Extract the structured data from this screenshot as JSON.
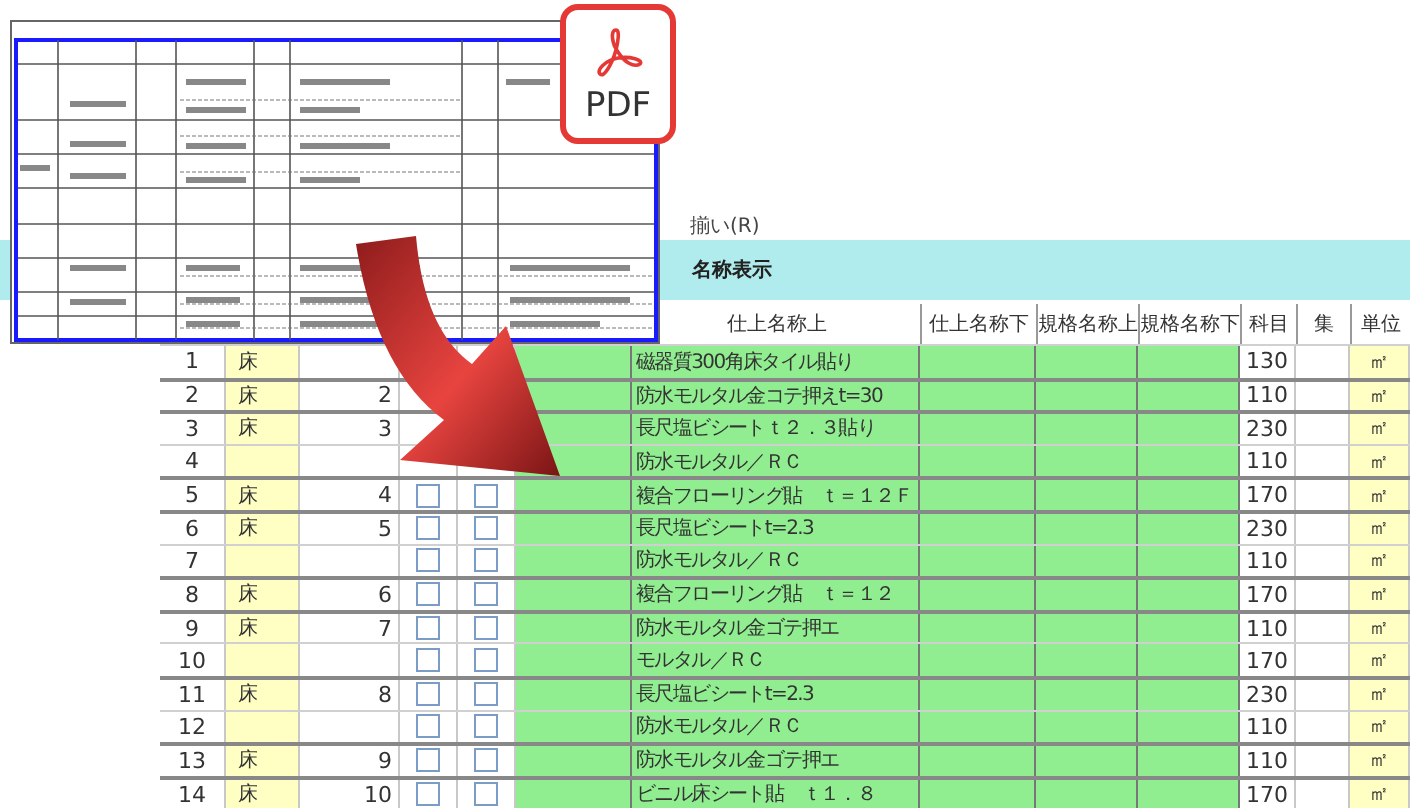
{
  "pdf_badge": {
    "label": "PDF"
  },
  "toolbar": {
    "align_label": "揃い(R)"
  },
  "name_panel": {
    "title": "名称表示"
  },
  "table": {
    "columns": [
      "仕上名称上",
      "仕上名称下",
      "規格名称上",
      "規格名称下",
      "科目",
      "集",
      "単位"
    ],
    "rows": [
      {
        "no": "1",
        "column_2": "床",
        "column_3": "",
        "finish_upper": "磁器質300角床タイル貼り",
        "subject": "130",
        "unit": "㎡"
      },
      {
        "no": "2",
        "column_2": "床",
        "column_3": "2",
        "finish_upper": "防水モルタル金コテ押えt=30",
        "subject": "110",
        "unit": "㎡"
      },
      {
        "no": "3",
        "column_2": "床",
        "column_3": "3",
        "finish_upper": "長尺塩ビシートｔ２．３貼り",
        "subject": "230",
        "unit": "㎡"
      },
      {
        "no": "4",
        "column_2": "",
        "column_3": "",
        "finish_upper": "防水モルタル／ＲＣ",
        "subject": "110",
        "unit": "㎡"
      },
      {
        "no": "5",
        "column_2": "床",
        "column_3": "4",
        "check_a": false,
        "check_b": false,
        "finish_upper": "複合フローリング貼　ｔ＝１２Ｆ",
        "subject": "170",
        "unit": "㎡"
      },
      {
        "no": "6",
        "column_2": "床",
        "column_3": "5",
        "check_a": false,
        "check_b": false,
        "finish_upper": "長尺塩ビシートt=2.3",
        "subject": "230",
        "unit": "㎡"
      },
      {
        "no": "7",
        "column_2": "",
        "column_3": "",
        "check_a": false,
        "check_b": false,
        "finish_upper": "防水モルタル／ＲＣ",
        "subject": "110",
        "unit": "㎡"
      },
      {
        "no": "8",
        "column_2": "床",
        "column_3": "6",
        "check_a": false,
        "check_b": false,
        "finish_upper": "複合フローリング貼　ｔ＝１２",
        "subject": "170",
        "unit": "㎡"
      },
      {
        "no": "9",
        "column_2": "床",
        "column_3": "7",
        "check_a": false,
        "check_b": false,
        "finish_upper": "防水モルタル金ゴテ押エ",
        "subject": "110",
        "unit": "㎡"
      },
      {
        "no": "10",
        "column_2": "",
        "column_3": "",
        "check_a": false,
        "check_b": false,
        "finish_upper": "モルタル／ＲＣ",
        "subject": "170",
        "unit": "㎡"
      },
      {
        "no": "11",
        "column_2": "床",
        "column_3": "8",
        "check_a": false,
        "check_b": false,
        "finish_upper": "長尺塩ビシートt=2.3",
        "subject": "230",
        "unit": "㎡"
      },
      {
        "no": "12",
        "column_2": "",
        "column_3": "",
        "check_a": false,
        "check_b": false,
        "finish_upper": "防水モルタル／ＲＣ",
        "subject": "110",
        "unit": "㎡"
      },
      {
        "no": "13",
        "column_2": "床",
        "column_3": "9",
        "check_a": false,
        "check_b": false,
        "finish_upper": "防水モルタル金ゴテ押エ",
        "subject": "110",
        "unit": "㎡"
      },
      {
        "no": "14",
        "column_2": "床",
        "column_3": "10",
        "check_a": false,
        "check_b": false,
        "finish_upper": "ビニル床シート貼　ｔ１．８",
        "subject": "170",
        "unit": "㎡"
      }
    ]
  }
}
